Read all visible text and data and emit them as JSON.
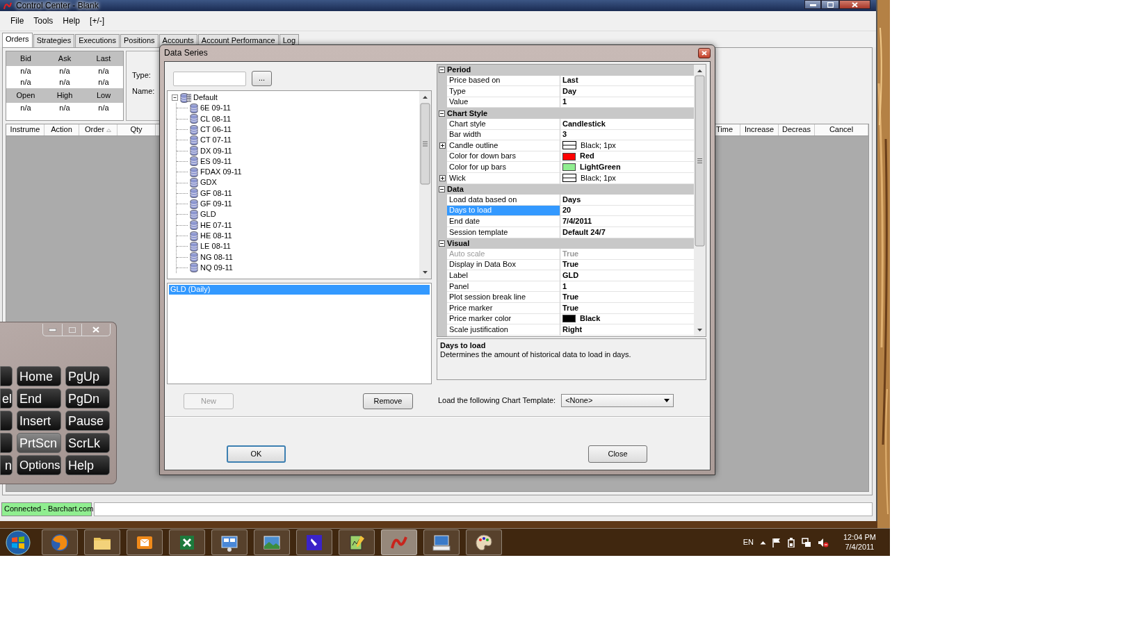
{
  "window": {
    "title": "Control Center - Blank"
  },
  "menu": [
    {
      "label": "File"
    },
    {
      "label": "Tools"
    },
    {
      "label": "Help"
    },
    {
      "label": "[+/-]"
    }
  ],
  "tabs": [
    {
      "label": "Orders",
      "selected": true
    },
    {
      "label": "Strategies",
      "selected": false
    },
    {
      "label": "Executions",
      "selected": false
    },
    {
      "label": "Positions",
      "selected": false
    },
    {
      "label": "Accounts",
      "selected": false
    },
    {
      "label": "Account Performance",
      "selected": false
    },
    {
      "label": "Log",
      "selected": false
    }
  ],
  "quote_grid": {
    "rows": [
      {
        "kind": "header",
        "cells": [
          "Bid",
          "Ask",
          "Last"
        ]
      },
      {
        "kind": "value",
        "cells": [
          "n/a",
          "n/a",
          "n/a"
        ]
      },
      {
        "kind": "value",
        "cells": [
          "n/a",
          "n/a",
          "n/a"
        ]
      },
      {
        "kind": "header",
        "cells": [
          "Open",
          "High",
          "Low"
        ]
      },
      {
        "kind": "value",
        "cells": [
          "n/a",
          "n/a",
          "n/a"
        ]
      }
    ]
  },
  "order_info": {
    "labels": [
      "Type:",
      "Name:"
    ]
  },
  "orders_table": {
    "columns": [
      {
        "label": "Instrume",
        "sorted": false
      },
      {
        "label": "Action",
        "sorted": false
      },
      {
        "label": "Order",
        "sorted": true
      },
      {
        "label": "Qty",
        "sorted": false
      }
    ],
    "columns_right": [
      {
        "label": "Time",
        "sorted": false
      },
      {
        "label": "Increase",
        "sorted": false
      },
      {
        "label": "Decreas",
        "sorted": false
      },
      {
        "label": "Cancel",
        "sorted": false
      }
    ]
  },
  "dialog": {
    "title": "Data Series",
    "browse_button": "...",
    "tree": {
      "label": "Default",
      "expanded": true,
      "children": [
        {
          "label": "6E 09-11"
        },
        {
          "label": "CL 08-11"
        },
        {
          "label": "CT 06-11"
        },
        {
          "label": "CT 07-11"
        },
        {
          "label": "DX 09-11"
        },
        {
          "label": "ES 09-11"
        },
        {
          "label": "FDAX 09-11"
        },
        {
          "label": "GDX"
        },
        {
          "label": "GF 08-11"
        },
        {
          "label": "GF 09-11"
        },
        {
          "label": "GLD"
        },
        {
          "label": "HE 07-11"
        },
        {
          "label": "HE 08-11"
        },
        {
          "label": "LE 08-11"
        },
        {
          "label": "NG 08-11"
        },
        {
          "label": "NQ 09-11"
        }
      ]
    },
    "series": [
      {
        "label": "GLD (Daily)",
        "selected": true
      }
    ],
    "new_button": {
      "label": "New",
      "disabled": true
    },
    "remove_button": {
      "label": "Remove",
      "disabled": false
    },
    "properties": [
      {
        "label": "Period",
        "expanded": true,
        "rows": [
          {
            "kind": "text",
            "name": "Price based on",
            "value": "Last",
            "selected": false,
            "disabled": false
          },
          {
            "kind": "text",
            "name": "Type",
            "value": "Day",
            "selected": false,
            "disabled": false
          },
          {
            "kind": "text",
            "name": "Value",
            "value": "1",
            "selected": false,
            "disabled": false
          }
        ]
      },
      {
        "label": "Chart Style",
        "expanded": true,
        "rows": [
          {
            "kind": "text",
            "name": "Chart style",
            "value": "Candlestick",
            "selected": false,
            "disabled": false
          },
          {
            "kind": "text",
            "name": "Bar width",
            "value": "3",
            "selected": false,
            "disabled": false
          },
          {
            "kind": "pen",
            "name": "Candle outline",
            "value": "Black; 1px",
            "selected": false,
            "disabled": false
          },
          {
            "kind": "color",
            "name": "Color for down bars",
            "value": "Red",
            "color": "#ff0000",
            "selected": false,
            "disabled": false
          },
          {
            "kind": "color",
            "name": "Color for up bars",
            "value": "LightGreen",
            "color": "#90ee90",
            "selected": false,
            "disabled": false
          },
          {
            "kind": "pen",
            "name": "Wick",
            "value": "Black; 1px",
            "selected": false,
            "disabled": false
          }
        ]
      },
      {
        "label": "Data",
        "expanded": true,
        "rows": [
          {
            "kind": "text",
            "name": "Load data based on",
            "value": "Days",
            "selected": false,
            "disabled": false
          },
          {
            "kind": "text",
            "name": "Days to load",
            "value": "20",
            "selected": true,
            "disabled": false
          },
          {
            "kind": "text",
            "name": "End date",
            "value": "7/4/2011",
            "selected": false,
            "disabled": false
          },
          {
            "kind": "text",
            "name": "Session template",
            "value": "Default 24/7",
            "selected": false,
            "disabled": false
          }
        ]
      },
      {
        "label": "Visual",
        "expanded": true,
        "rows": [
          {
            "kind": "text",
            "name": "Auto scale",
            "value": "True",
            "selected": false,
            "disabled": true
          },
          {
            "kind": "text",
            "name": "Display in Data Box",
            "value": "True",
            "selected": false,
            "disabled": false
          },
          {
            "kind": "text",
            "name": "Label",
            "value": "GLD",
            "selected": false,
            "disabled": false
          },
          {
            "kind": "text",
            "name": "Panel",
            "value": "1",
            "selected": false,
            "disabled": false
          },
          {
            "kind": "text",
            "name": "Plot session break line",
            "value": "True",
            "selected": false,
            "disabled": false
          },
          {
            "kind": "text",
            "name": "Price marker",
            "value": "True",
            "selected": false,
            "disabled": false
          },
          {
            "kind": "color",
            "name": "Price marker color",
            "value": "Black",
            "color": "#000000",
            "selected": false,
            "disabled": false
          },
          {
            "kind": "text",
            "name": "Scale justification",
            "value": "Right",
            "selected": false,
            "disabled": false
          }
        ]
      }
    ],
    "description": {
      "title": "Days to load",
      "text": "Determines the amount of historical data to load in days."
    },
    "template": {
      "label": "Load the following Chart Template:",
      "value": "<None>"
    },
    "ok_button": {
      "label": "OK",
      "default": true
    },
    "close_button": {
      "label": "Close",
      "default": false
    }
  },
  "keyboard": {
    "rows": [
      {
        "keys": [
          {
            "label": "Home",
            "pressed": false
          },
          {
            "label": "PgUp",
            "pressed": false
          }
        ]
      },
      {
        "edge_label": "el",
        "keys": [
          {
            "label": "End",
            "pressed": false
          },
          {
            "label": "PgDn",
            "pressed": false
          }
        ]
      },
      {
        "keys": [
          {
            "label": "Insert",
            "pressed": false
          },
          {
            "label": "Pause",
            "pressed": false
          }
        ]
      },
      {
        "keys": [
          {
            "label": "PrtScn",
            "pressed": true
          },
          {
            "label": "ScrLk",
            "pressed": false
          }
        ]
      },
      {
        "edge_label": "n",
        "keys": [
          {
            "label": "Options",
            "pressed": false
          },
          {
            "label": "Help",
            "pressed": false
          }
        ]
      }
    ]
  },
  "status_bar": {
    "text": "Connected - Barchart.com"
  },
  "taskbar": {
    "apps": [
      {
        "kind": "browser",
        "active": false
      },
      {
        "kind": "folder",
        "active": false
      },
      {
        "kind": "mail",
        "active": false
      },
      {
        "kind": "spreadsheet",
        "active": false
      },
      {
        "kind": "panel",
        "active": false
      },
      {
        "kind": "photos",
        "active": false
      },
      {
        "kind": "pen",
        "active": false
      },
      {
        "kind": "notepad",
        "active": false
      },
      {
        "kind": "logo",
        "active": true
      },
      {
        "kind": "keyboard",
        "active": false
      },
      {
        "kind": "paint",
        "active": false
      }
    ],
    "language": "EN",
    "time": "12:04 PM",
    "date": "7/4/2011"
  }
}
